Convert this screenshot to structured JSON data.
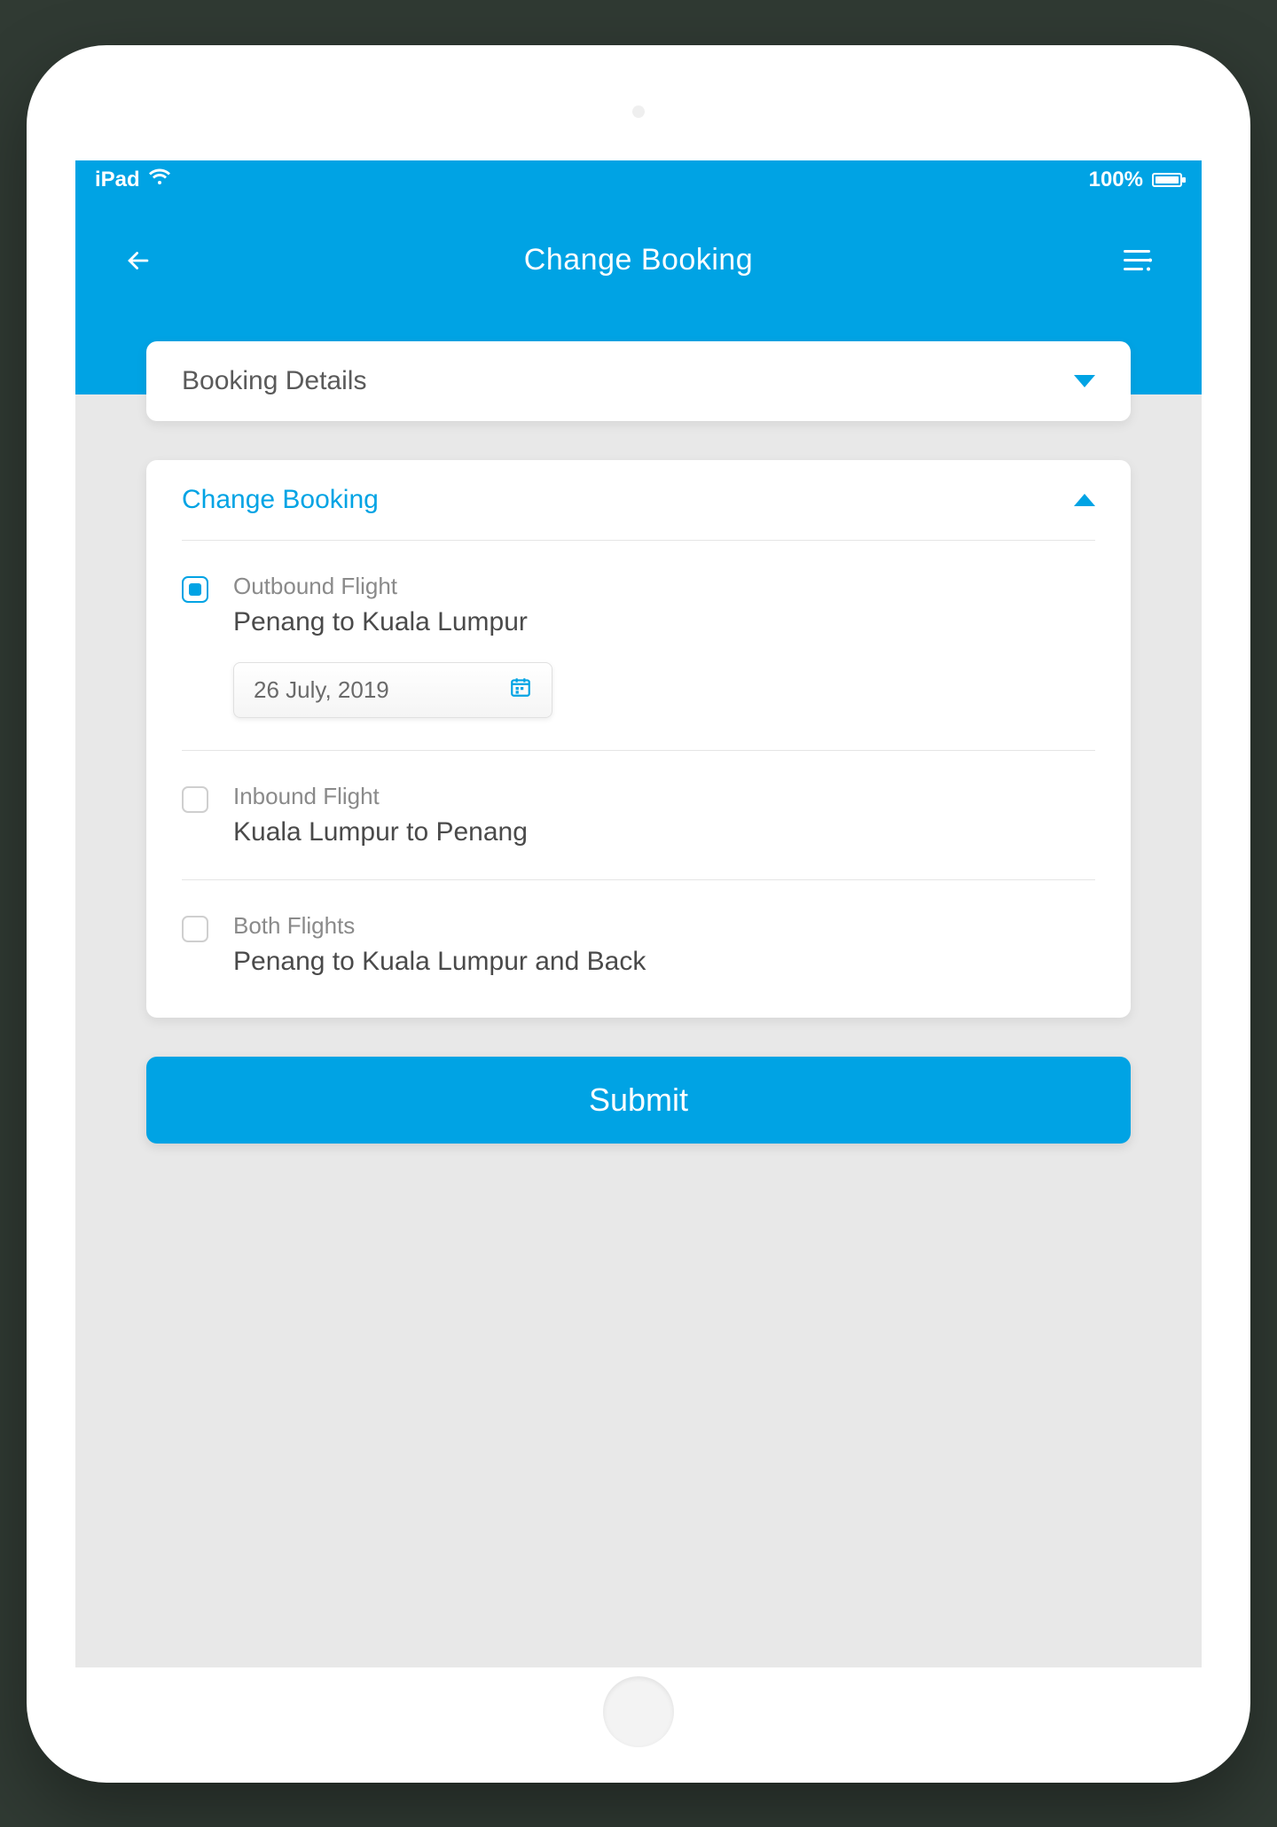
{
  "status_bar": {
    "device": "iPad",
    "battery_pct": "100%"
  },
  "header": {
    "title": "Change Booking"
  },
  "booking_details_card": {
    "title": "Booking Details"
  },
  "change_booking_card": {
    "title": "Change Booking",
    "options": [
      {
        "checked": true,
        "label": "Outbound Flight",
        "route": "Penang to Kuala Lumpur",
        "date": "26 July, 2019"
      },
      {
        "checked": false,
        "label": "Inbound Flight",
        "route": "Kuala Lumpur to Penang"
      },
      {
        "checked": false,
        "label": "Both Flights",
        "route": "Penang to Kuala Lumpur and Back"
      }
    ]
  },
  "submit_label": "Submit"
}
